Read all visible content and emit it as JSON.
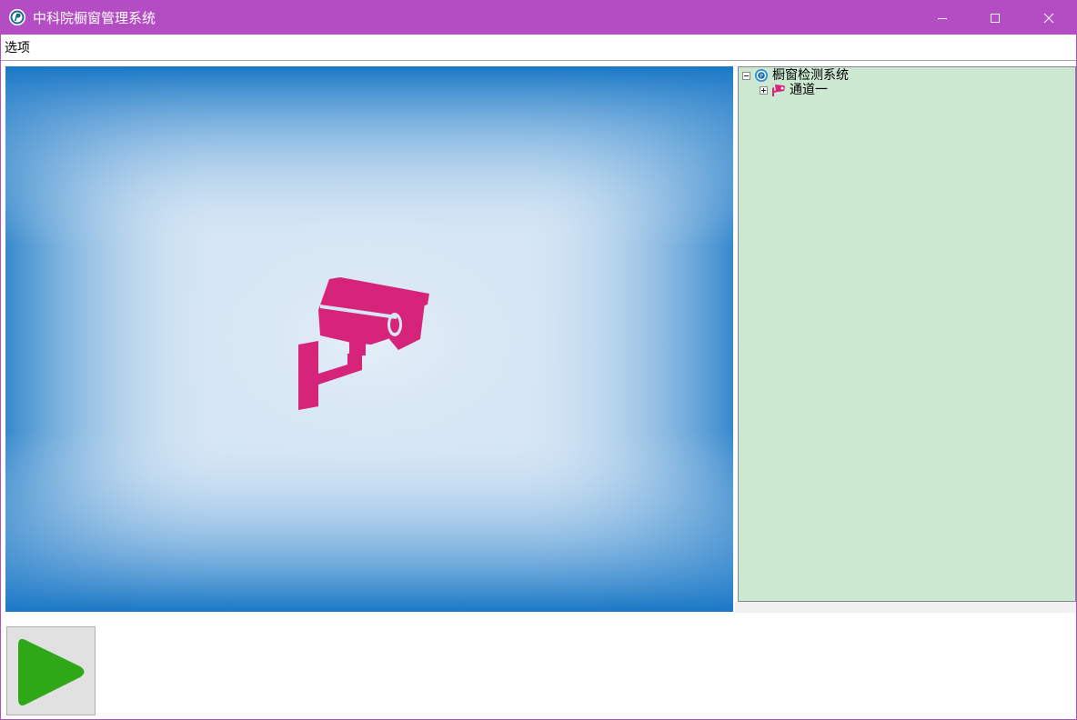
{
  "window": {
    "title": "中科院橱窗管理系统",
    "accent_color": "#b44dc3",
    "controls": {
      "minimize_icon": "minimize-icon",
      "maximize_icon": "maximize-icon",
      "close_icon": "close-icon"
    }
  },
  "menu": {
    "items": [
      {
        "label": "选项"
      }
    ]
  },
  "video": {
    "placeholder_icon": "security-camera-icon",
    "icon_color": "#d6247a",
    "background_edge_color": "#1a78c6",
    "background_center_color": "#d6e6f4"
  },
  "tree": {
    "background_color": "#cde8d0",
    "root": {
      "label": "橱窗检测系统",
      "icon": "globe-icon",
      "expanded": true,
      "children": [
        {
          "label": "通道一",
          "icon": "camera-icon",
          "expanded": false
        }
      ]
    }
  },
  "toolbar": {
    "play_icon": "play-icon",
    "play_color": "#2ea817"
  }
}
